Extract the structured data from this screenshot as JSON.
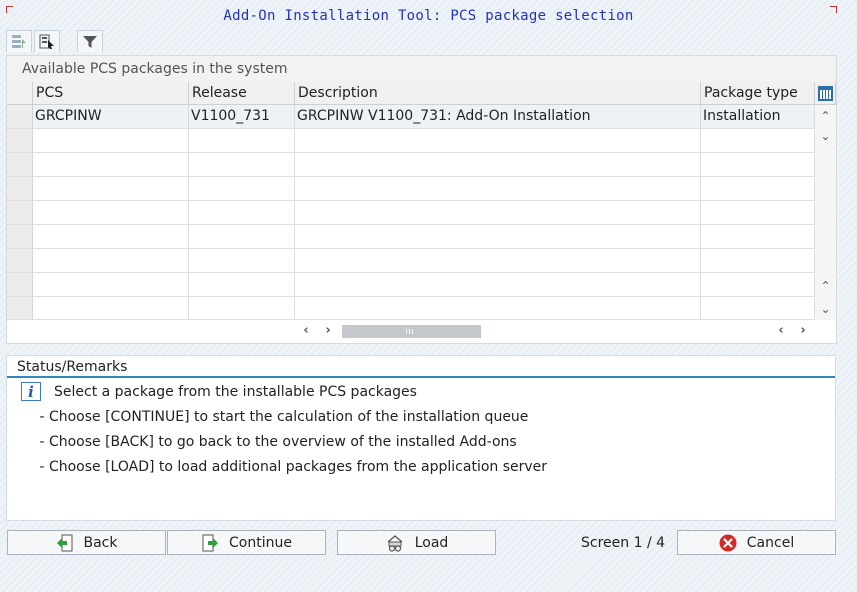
{
  "window": {
    "title": "Add-On Installation Tool: PCS package selection"
  },
  "toolbar": {
    "icons": [
      "select-all-icon",
      "select-block-icon",
      "filter-icon"
    ]
  },
  "packages_panel": {
    "title": "Available PCS packages in the system",
    "columns": [
      "PCS",
      "Release",
      "Description",
      "Package type"
    ],
    "rows": [
      {
        "pcs": "GRCPINW",
        "release": "V1100_731",
        "description": "GRCPINW V1100_731: Add-On Installation",
        "type": "Installation"
      }
    ],
    "layout_icon": "column-layout-icon"
  },
  "status": {
    "title": "Status/Remarks",
    "lines": [
      "Select a package from the installable PCS packages",
      " - Choose [CONTINUE] to start the calculation of the installation queue",
      " - Choose [BACK] to go back to the overview of the installed Add-ons",
      " - Choose [LOAD] to load additional packages from the application server"
    ]
  },
  "footer": {
    "back_label": "Back",
    "continue_label": "Continue",
    "load_label": "Load",
    "screen_label": "Screen 1 / 4",
    "cancel_label": "Cancel"
  },
  "colors": {
    "title_text": "#2233bb",
    "status_accent": "#2e8bb8",
    "cancel_icon": "#d42a2a",
    "arrow_icon": "#2e9e3e"
  }
}
